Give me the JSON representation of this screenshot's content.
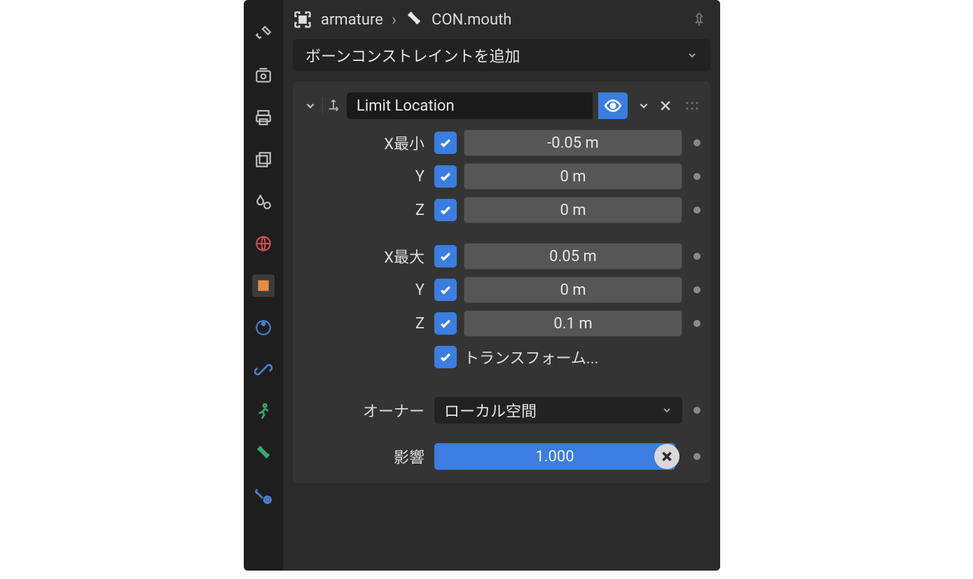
{
  "breadcrumb": {
    "armature": "armature",
    "bone": "CON.mouth"
  },
  "add_constraint": "ボーンコンストレイントを追加",
  "constraint": {
    "name": "Limit Location",
    "rows_min": [
      {
        "label": "X最小",
        "value": "-0.05 m"
      },
      {
        "label": "Y",
        "value": "0 m"
      },
      {
        "label": "Z",
        "value": "0 m"
      }
    ],
    "rows_max": [
      {
        "label": "X最大",
        "value": "0.05 m"
      },
      {
        "label": "Y",
        "value": "0 m"
      },
      {
        "label": "Z",
        "value": "0.1 m"
      }
    ],
    "transform_label": "トランスフォーム...",
    "owner_label": "オーナー",
    "owner_value": "ローカル空間",
    "influence_label": "影響",
    "influence_value": "1.000"
  }
}
